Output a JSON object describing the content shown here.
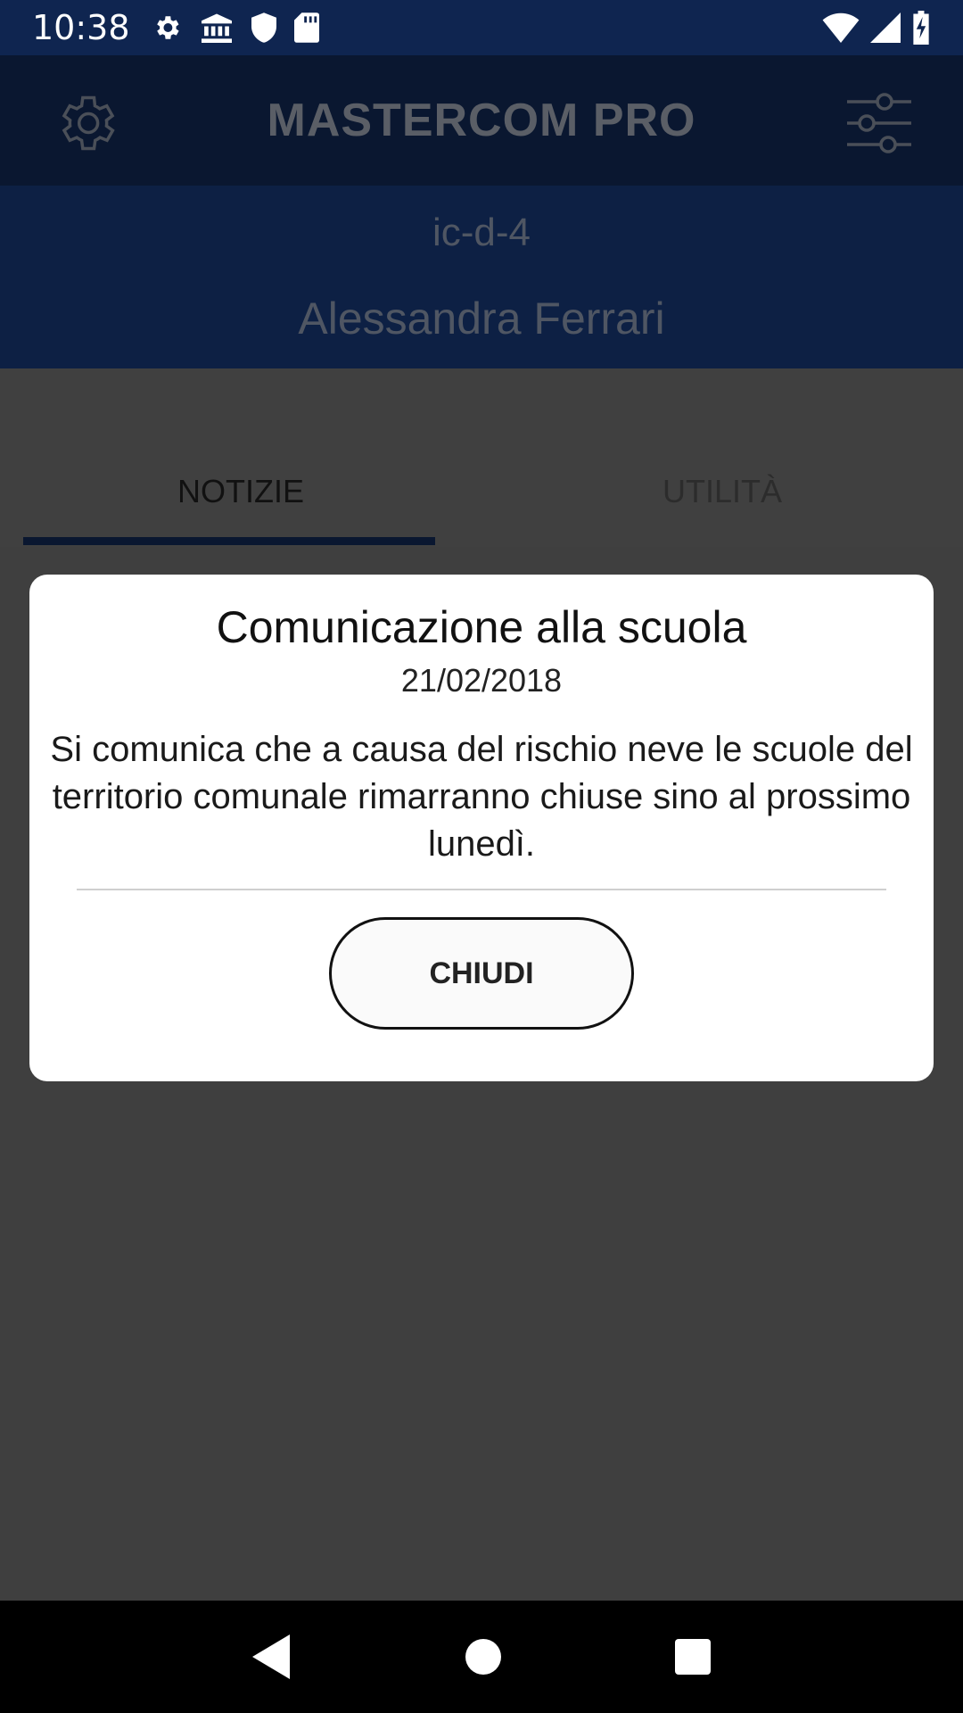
{
  "status_bar": {
    "time": "10:38",
    "icons_left": [
      "settings-icon",
      "bank-icon",
      "shield-icon",
      "sd-card-icon"
    ],
    "icons_right": [
      "wifi-icon",
      "signal-icon",
      "battery-charging-icon"
    ]
  },
  "app_bar": {
    "title": "MASTERCOM PRO",
    "left_icon": "gear-icon",
    "right_icon": "sliders-icon"
  },
  "user": {
    "code": "ic-d-4",
    "name": "Alessandra Ferrari"
  },
  "tabs": [
    {
      "label": "NOTIZIE",
      "selected": true
    },
    {
      "label": "UTILITÀ",
      "selected": false
    }
  ],
  "dialog": {
    "title": "Comunicazione alla scuola",
    "date": "21/02/2018",
    "message": "Si comunica che a causa del rischio neve le scuole del territorio comunale rimarranno chiuse sino al prossimo lunedì.",
    "close_label": "CHIUDI"
  },
  "nav_bar": {
    "buttons": [
      "back-icon",
      "home-icon",
      "recents-icon"
    ]
  },
  "colors": {
    "status_bar": "#0f2550",
    "app_bar": "#0a1730",
    "user_band": "#0d2044",
    "scrim": "#3f3f3f"
  }
}
